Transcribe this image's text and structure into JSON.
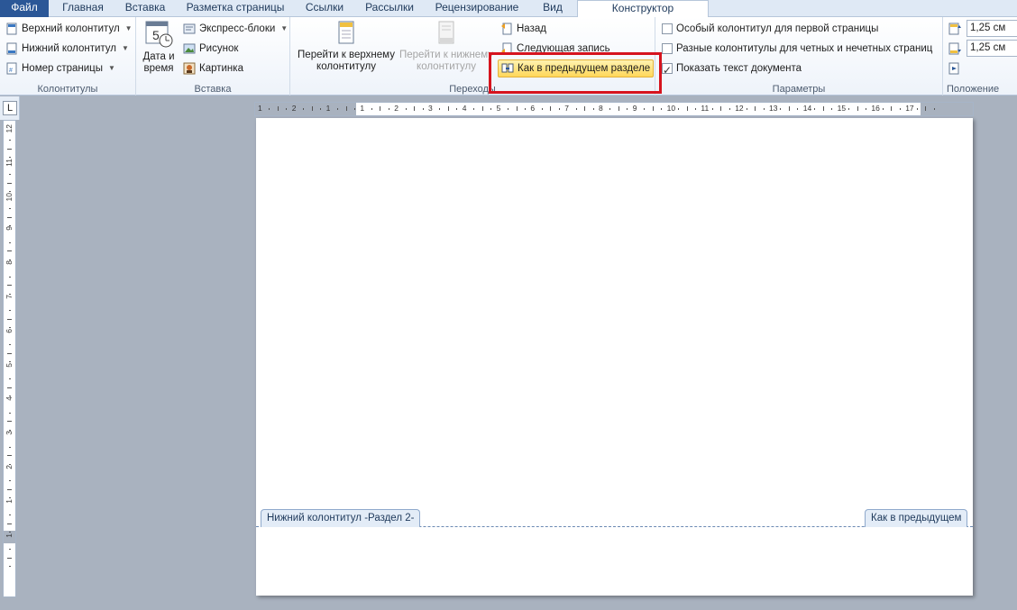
{
  "tabs": [
    "Файл",
    "Главная",
    "Вставка",
    "Разметка страницы",
    "Ссылки",
    "Рассылки",
    "Рецензирование",
    "Вид",
    "Конструктор"
  ],
  "ribbon": {
    "kolontituly": {
      "label": "Колонтитулы",
      "items": [
        "Верхний колонтитул",
        "Нижний колонтитул",
        "Номер страницы"
      ]
    },
    "vstavka": {
      "label": "Вставка",
      "date_time": "Дата и время",
      "date_line1": "Дата и",
      "date_line2": "время",
      "items": [
        "Экспресс-блоки",
        "Рисунок",
        "Картинка"
      ]
    },
    "perehody": {
      "label": "Переходы",
      "go_header_line1": "Перейти к верхнему",
      "go_header_line2": "колонтитулу",
      "go_footer_line1": "Перейти к нижнему",
      "go_footer_line2": "колонтитулу",
      "back": "Назад",
      "next": "Следующая запись",
      "link_previous": "Как в предыдущем разделе"
    },
    "parametry": {
      "label": "Параметры",
      "options": [
        {
          "text": "Особый колонтитул для первой страницы",
          "checked": false
        },
        {
          "text": "Разные колонтитулы для четных и нечетных страниц",
          "checked": false
        },
        {
          "text": "Показать текст документа",
          "checked": true
        }
      ]
    },
    "polozhenie": {
      "label": "Положение",
      "header_from_top": "1,25 см",
      "footer_from_bottom": "1,25 см"
    }
  },
  "document": {
    "footer_label": "Нижний колонтитул -Раздел 2-",
    "same_as_previous": "Как в предыдущем"
  },
  "ruler": {
    "h_numbers": [
      "1",
      "2",
      "1",
      "1",
      "2",
      "3",
      "4",
      "5",
      "6",
      "7",
      "8",
      "9",
      "10",
      "11",
      "12",
      "13",
      "14",
      "15",
      "16",
      "17"
    ],
    "v_numbers": [
      "12",
      "11",
      "10",
      "9",
      "8",
      "7",
      "6",
      "5",
      "4",
      "3",
      "2",
      "1",
      "1"
    ]
  },
  "colors": {
    "file_tab": "#2b5797",
    "highlight": "#ffd75a",
    "callout_border": "#d6141e"
  }
}
